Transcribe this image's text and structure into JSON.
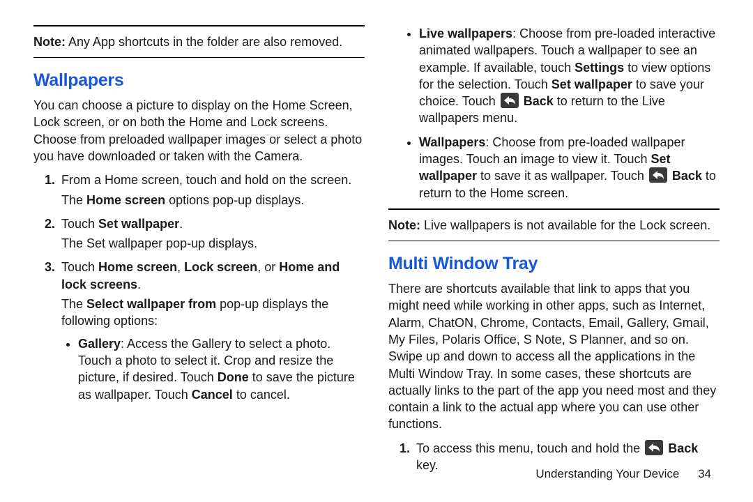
{
  "left": {
    "note_prefix": "Note:",
    "note_text": " Any App shortcuts in the folder are also removed.",
    "h_wallpapers": "Wallpapers",
    "intro": "You can choose a picture to display on the Home Screen, Lock screen, or on both the Home and Lock screens. Choose from preloaded wallpaper images or select a photo you have downloaded or taken with the Camera.",
    "step1_a": "From a Home screen, touch and hold on the screen.",
    "step1_b_pre": "The ",
    "step1_b_bold": "Home screen",
    "step1_b_post": " options pop-up displays.",
    "step2_pre": "Touch ",
    "step2_bold": "Set wallpaper",
    "step2_post": ".",
    "step2_sub": "The Set wallpaper pop-up displays.",
    "step3_pre": "Touch ",
    "step3_b1": "Home screen",
    "step3_mid1": ", ",
    "step3_b2": "Lock screen",
    "step3_mid2": ", or ",
    "step3_b3": "Home and lock screens",
    "step3_post": ".",
    "step3_sub_pre": "The ",
    "step3_sub_bold": "Select wallpaper from",
    "step3_sub_post": " pop-up displays the following options:",
    "bullet_gallery_label": "Gallery",
    "bullet_gallery_a": ": Access the Gallery to select a photo. Touch a photo to select it. Crop and resize the picture, if desired. Touch ",
    "bullet_gallery_done": "Done",
    "bullet_gallery_b": " to save the picture as wallpaper. Touch ",
    "bullet_gallery_cancel": "Cancel",
    "bullet_gallery_c": " to cancel."
  },
  "right": {
    "bullet_live_label": "Live wallpapers",
    "bullet_live_a": ": Choose from pre-loaded interactive animated wallpapers. Touch a wallpaper to see an example. If available, touch ",
    "bullet_live_settings": "Settings",
    "bullet_live_b": " to view options for the selection. Touch ",
    "bullet_live_setwp": "Set wallpaper",
    "bullet_live_c": " to save your choice. Touch ",
    "bullet_live_back": "Back",
    "bullet_live_d": " to return to the Live wallpapers menu.",
    "bullet_wp_label": "Wallpapers",
    "bullet_wp_a": ": Choose from pre-loaded wallpaper images. Touch an image to view it. Touch ",
    "bullet_wp_setwp": "Set wallpaper",
    "bullet_wp_b": " to save it as wallpaper. Touch ",
    "bullet_wp_back": "Back",
    "bullet_wp_c": " to return to the Home screen.",
    "note2_prefix": "Note:",
    "note2_text": " Live wallpapers is not available for the Lock screen.",
    "h_multi": "Multi Window Tray",
    "multi_intro": "There are shortcuts available that link to apps that you might need while working in other apps, such as Internet, Alarm, ChatON, Chrome, Contacts, Email, Gallery, Gmail, My Files, Polaris Office, S Note, S Planner, and so on. Swipe up and down to access all the applications in the Multi Window Tray. In some cases, these shortcuts are actually links to the part of the app you need most and they contain a link to the actual app where you can use other functions.",
    "multi_step1_a": "To access this menu, touch and hold the ",
    "multi_step1_back": "Back",
    "multi_step1_b": " key."
  },
  "footer": {
    "section": "Understanding Your Device",
    "page": "34"
  }
}
